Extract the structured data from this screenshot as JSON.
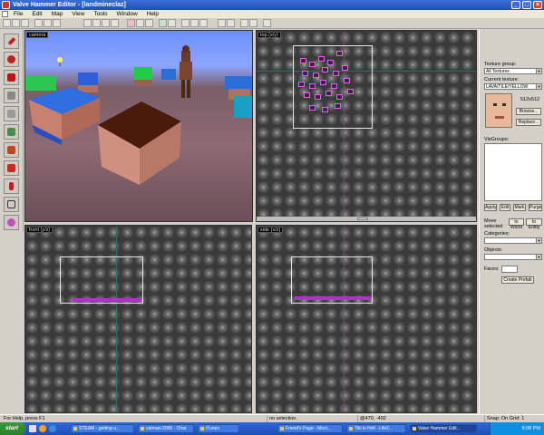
{
  "window": {
    "title": "Valve Hammer Editor - [landmineclaz]",
    "minimize_icon": "minimize-icon",
    "maximize_icon": "maximize-icon",
    "close_icon": "close-icon"
  },
  "menu": {
    "items": [
      "File",
      "Edit",
      "Map",
      "View",
      "Tools",
      "Window",
      "Help"
    ]
  },
  "viewports": {
    "camera": {
      "label": "camera"
    },
    "top": {
      "label": "top (x/y)"
    },
    "front": {
      "label": "front (y/z)"
    },
    "side": {
      "label": "side (x/z)"
    }
  },
  "panel": {
    "texture_group_label": "Texture group:",
    "texture_group_value": "All Textures",
    "current_texture_label": "Current texture:",
    "current_texture_value": "LAVA/TILE/YELLOW",
    "texture_size": "512x512",
    "browse_label": "Browse...",
    "replace_label": "Replace...",
    "vis_groups_label": "VisGroups:",
    "apply_label": "Apply",
    "edit_label": "Edit",
    "mark_label": "Mark",
    "purge_label": "Purge",
    "move_selected_label": "Move selected",
    "to_world_label": "to World",
    "to_entity_label": "to Entity",
    "categories_label": "Categories:",
    "objects_label": "Objects:",
    "faces_label": "Faces:",
    "create_prefab_label": "Create Prefab"
  },
  "status": {
    "help": "For Help, press F1",
    "selection": "no selection.",
    "coords": "@470, -492",
    "snap": "Snap: On Grid: 1"
  },
  "taskbar": {
    "start_label": "start",
    "tasks": [
      {
        "label": "STEAM - getting u...",
        "active": false
      },
      {
        "label": "catman-2000 - Chat",
        "active": false
      },
      {
        "label": "iTunes",
        "active": false
      },
      {
        "label": "Friend's Page - Mozi...",
        "active": false
      },
      {
        "label": "Tiki is Hell - Life2...",
        "active": false
      },
      {
        "label": "Valve Hammer Edit...",
        "active": true
      }
    ],
    "clock": "9:08 PM"
  }
}
